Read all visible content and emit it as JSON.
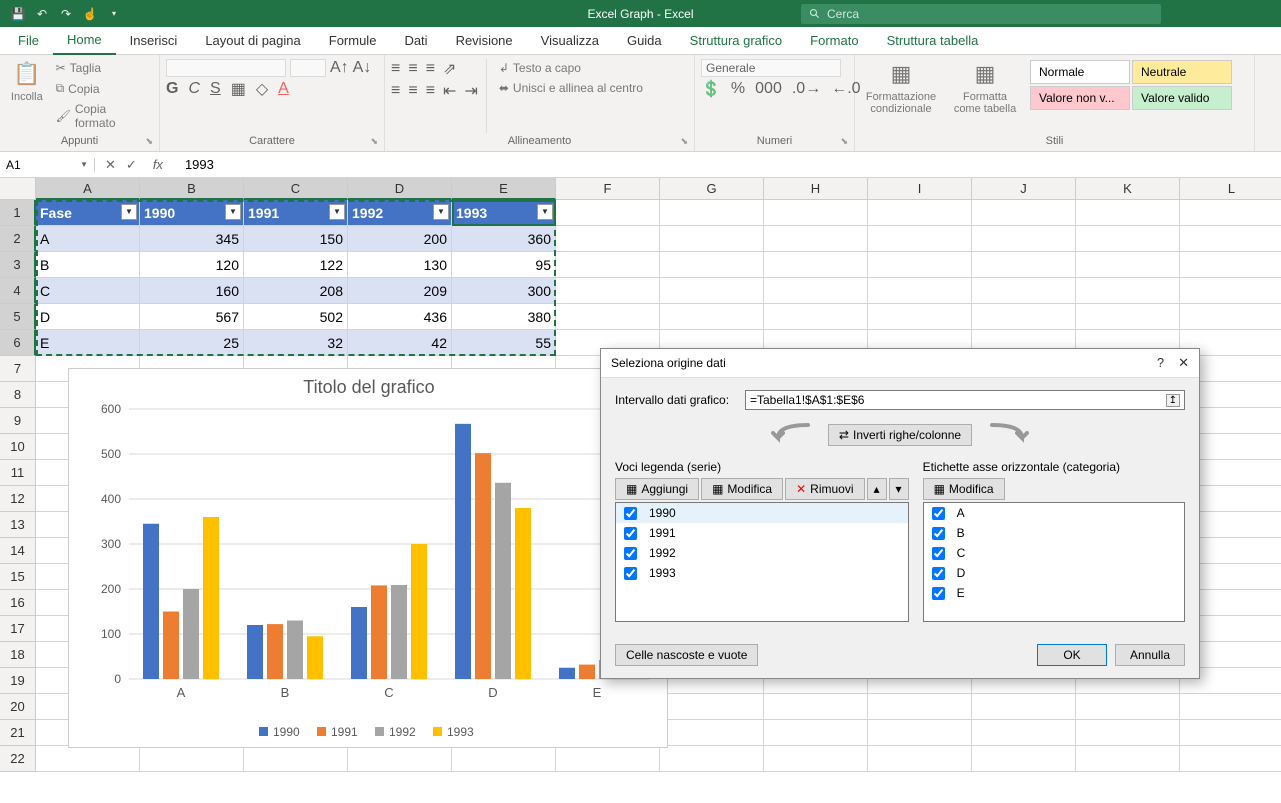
{
  "titlebar": {
    "title": "Excel Graph  -  Excel",
    "search_placeholder": "Cerca"
  },
  "ribbon_tabs": [
    "File",
    "Home",
    "Inserisci",
    "Layout di pagina",
    "Formule",
    "Dati",
    "Revisione",
    "Visualizza",
    "Guida",
    "Struttura grafico",
    "Formato",
    "Struttura tabella"
  ],
  "ribbon": {
    "appunti": {
      "label": "Appunti",
      "incolla": "Incolla",
      "taglia": "Taglia",
      "copia": "Copia",
      "copia_formato": "Copia formato"
    },
    "carattere": {
      "label": "Carattere"
    },
    "allineamento": {
      "label": "Allineamento",
      "testo_a_capo": "Testo a capo",
      "unisci": "Unisci e allinea al centro"
    },
    "numeri": {
      "label": "Numeri",
      "format": "Generale"
    },
    "stili_group": {
      "label": "Stili",
      "fc": "Formattazione condizionale",
      "ft": "Formatta come tabella"
    },
    "stili": {
      "normale": "Normale",
      "neutrale": "Neutrale",
      "valore_nv": "Valore non v...",
      "valore_valido": "Valore valido"
    }
  },
  "formula_bar": {
    "name_box": "A1",
    "formula": "1993"
  },
  "columns": [
    "A",
    "B",
    "C",
    "D",
    "E",
    "F",
    "G",
    "H",
    "I",
    "J",
    "K",
    "L"
  ],
  "rows": [
    "1",
    "2",
    "3",
    "4",
    "5",
    "6",
    "7",
    "8",
    "9",
    "10",
    "11",
    "12",
    "13",
    "14",
    "15",
    "16",
    "17",
    "18",
    "19",
    "20",
    "21",
    "22"
  ],
  "table": {
    "headers": [
      "Fase",
      "1990",
      "1991",
      "1992",
      "1993"
    ],
    "data": [
      [
        "A",
        345,
        150,
        200,
        360
      ],
      [
        "B",
        120,
        122,
        130,
        95
      ],
      [
        "C",
        160,
        208,
        209,
        300
      ],
      [
        "D",
        567,
        502,
        436,
        380
      ],
      [
        "E",
        25,
        32,
        42,
        55
      ]
    ]
  },
  "chart_data": {
    "type": "bar",
    "title": "Titolo del grafico",
    "categories": [
      "A",
      "B",
      "C",
      "D",
      "E"
    ],
    "series": [
      {
        "name": "1990",
        "values": [
          345,
          120,
          160,
          567,
          25
        ],
        "color": "#4472c4"
      },
      {
        "name": "1991",
        "values": [
          150,
          122,
          208,
          502,
          32
        ],
        "color": "#ed7d31"
      },
      {
        "name": "1992",
        "values": [
          200,
          130,
          209,
          436,
          42
        ],
        "color": "#a5a5a5"
      },
      {
        "name": "1993",
        "values": [
          360,
          95,
          300,
          380,
          55
        ],
        "color": "#ffc000"
      }
    ],
    "ylim": [
      0,
      600
    ],
    "yticks": [
      0,
      100,
      200,
      300,
      400,
      500,
      600
    ]
  },
  "dialog": {
    "title": "Seleziona origine dati",
    "range_label": "Intervallo dati grafico:",
    "range_value": "=Tabella1!$A$1:$E$6",
    "switch": "Inverti righe/colonne",
    "series_title": "Voci legenda (serie)",
    "series_btns": {
      "add": "Aggiungi",
      "edit": "Modifica",
      "remove": "Rimuovi"
    },
    "series_items": [
      "1990",
      "1991",
      "1992",
      "1993"
    ],
    "cat_title": "Etichette asse orizzontale (categoria)",
    "cat_btns": {
      "edit": "Modifica"
    },
    "cat_items": [
      "A",
      "B",
      "C",
      "D",
      "E"
    ],
    "hidden_btn": "Celle nascoste e vuote",
    "ok": "OK",
    "cancel": "Annulla"
  }
}
